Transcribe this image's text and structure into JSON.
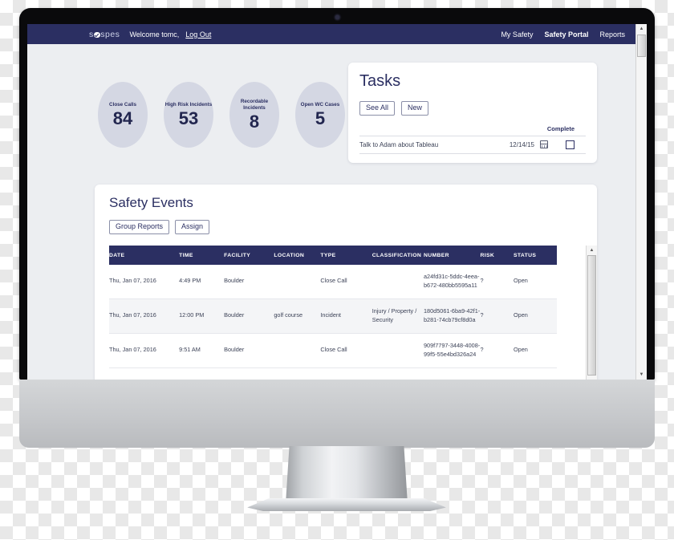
{
  "navbar": {
    "brand_pre": "s",
    "brand_post": "spes",
    "welcome": "Welcome tomc,",
    "logout": "Log Out",
    "links": [
      {
        "label": "My Safety",
        "active": false
      },
      {
        "label": "Safety Portal",
        "active": true
      },
      {
        "label": "Reports",
        "active": false
      }
    ],
    "background": "#2b2f62"
  },
  "kpis": [
    {
      "label": "Close Calls",
      "value": "84"
    },
    {
      "label": "High Risk Incidents",
      "value": "53"
    },
    {
      "label": "Recordable Incidents",
      "value": "8"
    },
    {
      "label": "Open WC Cases",
      "value": "5"
    }
  ],
  "tasks": {
    "title": "Tasks",
    "see_all_label": "See All",
    "new_label": "New",
    "complete_header": "Complete",
    "rows": [
      {
        "name": "Talk to Adam about Tableau",
        "date": "12/14/15",
        "calendar_icon": "calendar-icon",
        "complete": false
      }
    ]
  },
  "safety_events": {
    "title": "Safety Events",
    "group_reports_label": "Group Reports",
    "assign_label": "Assign",
    "columns": [
      "DATE",
      "TIME",
      "FACILITY",
      "LOCATION",
      "TYPE",
      "CLASSIFICATION",
      "NUMBER",
      "RISK",
      "STATUS"
    ],
    "rows": [
      {
        "date": "Thu, Jan 07, 2016",
        "time": "4:49 PM",
        "facility": "Boulder",
        "location": "",
        "type": "Close Call",
        "classification": "",
        "number": "a24fd31c-5ddc-4eea-b672-480bb5595a11",
        "risk": "?",
        "status": "Open"
      },
      {
        "date": "Thu, Jan 07, 2016",
        "time": "12:00 PM",
        "facility": "Boulder",
        "location": "golf course",
        "type": "Incident",
        "classification": "Injury / Property / Security",
        "number": "180d5061-6ba9-42f1-b281-74cb79cf8d0a",
        "risk": "?",
        "status": "Open"
      },
      {
        "date": "Thu, Jan 07, 2016",
        "time": "9:51 AM",
        "facility": "Boulder",
        "location": "",
        "type": "Close Call",
        "classification": "",
        "number": "909f7797-3448-4008-99f5-55e4bd326a24",
        "risk": "?",
        "status": "Open"
      }
    ]
  },
  "scrollbar": {
    "up_arrow": "▲",
    "down_arrow": "▼"
  },
  "colors": {
    "brand_navy": "#2b2f62",
    "page_bg": "#eceef1",
    "kpi_circle": "#d4d7e3"
  }
}
